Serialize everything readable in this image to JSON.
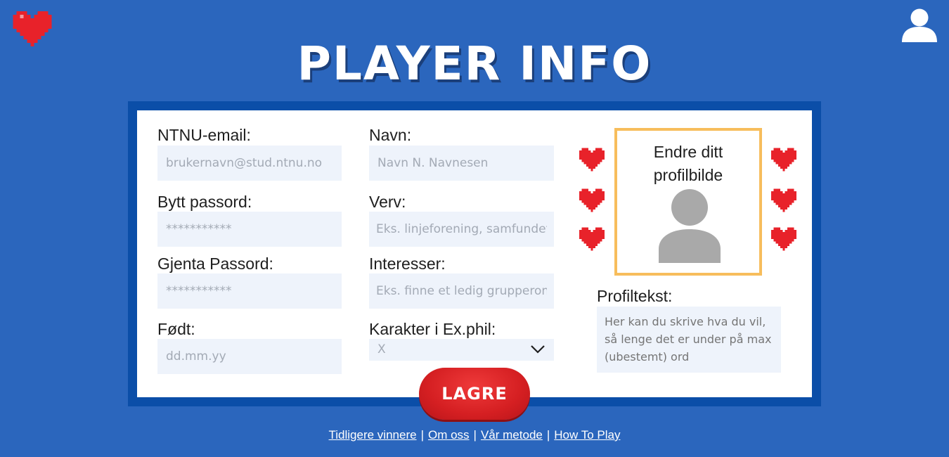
{
  "title": "PLAYER INFO",
  "colors": {
    "background": "#2b66bd",
    "frame": "#0b4ea8",
    "heart": "#e8222a",
    "avatar_border": "#f7bd5c",
    "save_button": "#d51f22"
  },
  "icons": {
    "logo": "pixel-heart-icon",
    "account": "user-icon",
    "hearts": "pixel-heart-icon",
    "select": "chevron-down-icon"
  },
  "form": {
    "email": {
      "label": "NTNU-email:",
      "placeholder": "brukernavn@stud.ntnu.no"
    },
    "name": {
      "label": "Navn:",
      "placeholder": "Navn N. Navnesen"
    },
    "password": {
      "label": "Bytt passord:",
      "placeholder": "***********"
    },
    "role": {
      "label": "Verv:",
      "placeholder": "Eks. linjeforening, samfundet"
    },
    "repeat_password": {
      "label": "Gjenta Passord:",
      "placeholder": "***********"
    },
    "interests": {
      "label": "Interesser:",
      "placeholder": "Eks. finne et ledig grupperom"
    },
    "born": {
      "label": "Født:",
      "placeholder": "dd.mm.yy"
    },
    "grade": {
      "label": "Karakter i Ex.phil:",
      "selected": "X"
    },
    "avatar": {
      "caption_line1": "Endre ditt",
      "caption_line2": "profilbilde"
    },
    "profile_text": {
      "label": "Profiltekst:",
      "placeholder": "Her kan du skrive hva du vil, så lenge det er under på max (ubestemt) ord"
    },
    "save_label": "LAGRE"
  },
  "footer": {
    "links": [
      "Tidligere vinnere",
      "Om oss",
      "Vår metode",
      "How To Play"
    ],
    "separator": "|"
  }
}
